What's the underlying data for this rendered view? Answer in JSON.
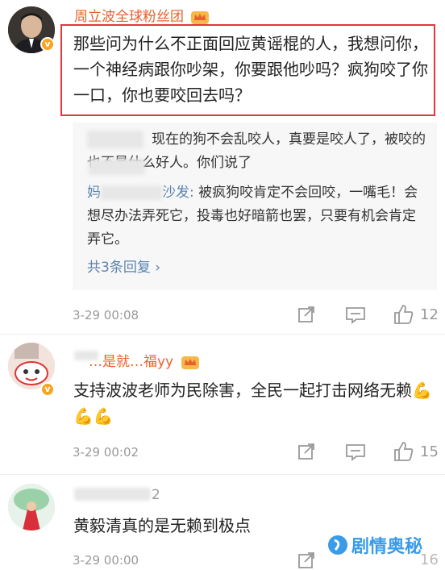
{
  "comments": [
    {
      "username": "周立波全球粉丝团",
      "content": "那些问为什么不正面回应黄谣棍的人，我想问你，一个神经病跟你吵架，你要跟他吵吗？疯狗咬了你一口，你也要咬回去吗？",
      "replies": [
        {
          "name": "",
          "text": "现在的狗不会乱咬人，真要是咬人了，被咬的也不是什么好人。你们说了"
        },
        {
          "name": "妈",
          "name_suffix": "沙发",
          "text": "被疯狗咬肯定不会回咬，一嘴毛！会想尽办法弄死它，投毒也好暗箭也罢，只要有机会肯定弄它。"
        }
      ],
      "more_replies": "共3条回复 ›",
      "time": "3-29 00:08",
      "likes": "12"
    },
    {
      "username": "…是就…福yy",
      "content": "支持波波老师为民除害，全民一起打击网络无赖💪💪💪",
      "time": "3-29 00:02",
      "likes": "15"
    },
    {
      "username": "2",
      "content": "黄毅清真的是无赖到极点",
      "time": "3-29 00:00",
      "likes": "16"
    }
  ],
  "watermark": "剧情奥秘",
  "colors": {
    "accent": "#e8612c",
    "link": "#5b84b1",
    "highlight": "#e0383e",
    "verified": "#f6a623"
  }
}
